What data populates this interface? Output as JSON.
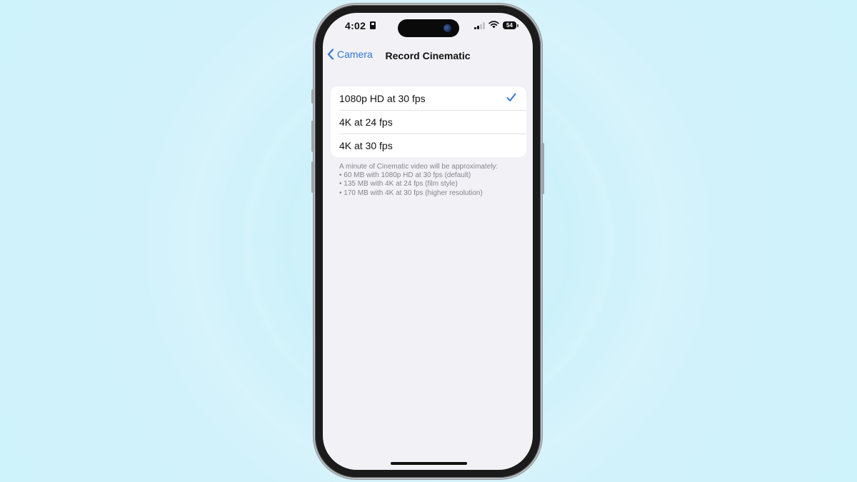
{
  "status_bar": {
    "time": "4:02",
    "battery_level": "54",
    "signal_bars_active": 2,
    "signal_bars_total": 4,
    "icons": [
      "sim-card-icon",
      "signal-icon",
      "wifi-icon",
      "battery-icon"
    ]
  },
  "nav": {
    "back_label": "Camera",
    "title": "Record Cinematic"
  },
  "options": [
    {
      "label": "1080p HD at 30 fps",
      "selected": true
    },
    {
      "label": "4K at 24 fps",
      "selected": false
    },
    {
      "label": "4K at 30 fps",
      "selected": false
    }
  ],
  "footnote": {
    "intro": "A minute of Cinematic video will be approximately:",
    "lines": [
      "• 60 MB with 1080p HD at 30 fps (default)",
      "• 135 MB with 4K at 24 fps (film style)",
      "• 170 MB with 4K at 30 fps (higher resolution)"
    ]
  },
  "colors": {
    "accent": "#3478d6",
    "background": "#f1f1f6",
    "page_background": "#cff3fb",
    "footnote_text": "#85858b"
  }
}
